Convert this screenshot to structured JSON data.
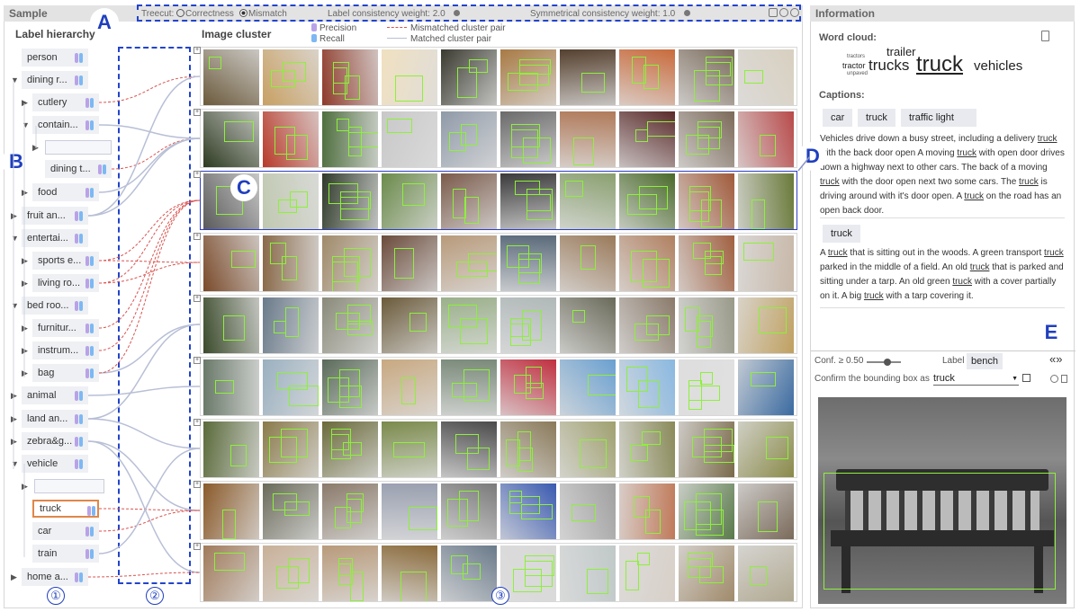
{
  "sample_title": "Sample",
  "info_title": "Information",
  "toolbar": {
    "treecut_label": "Treecut:",
    "opt_correctness": "Correctness",
    "opt_mismatch": "Mismatch",
    "label_weight": "Label consistency weight: 2.0",
    "sym_weight": "Symmetrical consistency weight: 1.0"
  },
  "badges": {
    "a": "A",
    "b": "B",
    "c": "C",
    "d": "D",
    "e": "E"
  },
  "col_numbers": [
    "①",
    "②",
    "③"
  ],
  "hierarchy_title": "Label hierarchy",
  "cluster_title": "Image cluster",
  "legend": {
    "precision": "Precision",
    "recall": "Recall",
    "mismatched": "Mismatched cluster pair",
    "matched": "Matched cluster pair",
    "precision_color": "#b9a3e8",
    "recall_color": "#7db8f2",
    "mismatched_color": "#d9534f",
    "matched_color": "#b8bfd6"
  },
  "tree_nodes": [
    {
      "label": "person",
      "expanded": null
    },
    {
      "label": "dining r...",
      "expanded": true
    },
    {
      "label": "cutlery",
      "expanded": false
    },
    {
      "label": "contain...",
      "expanded": true
    },
    {
      "label": "dining t...",
      "expanded": null
    },
    {
      "label": "food",
      "expanded": false
    },
    {
      "label": "fruit an...",
      "expanded": false
    },
    {
      "label": "entertai...",
      "expanded": true
    },
    {
      "label": "sports e...",
      "expanded": false
    },
    {
      "label": "living ro...",
      "expanded": false
    },
    {
      "label": "bed roo...",
      "expanded": true
    },
    {
      "label": "furnitur...",
      "expanded": false
    },
    {
      "label": "instrum...",
      "expanded": false
    },
    {
      "label": "bag",
      "expanded": false
    },
    {
      "label": "animal",
      "expanded": false
    },
    {
      "label": "land an...",
      "expanded": false
    },
    {
      "label": "zebra&g...",
      "expanded": false
    },
    {
      "label": "vehicle",
      "expanded": true
    },
    {
      "label": "truck",
      "expanded": null
    },
    {
      "label": "car",
      "expanded": null
    },
    {
      "label": "train",
      "expanded": null
    },
    {
      "label": "home a...",
      "expanded": false
    }
  ],
  "information": {
    "word_cloud_title": "Word cloud:",
    "word_cloud": [
      "trailer",
      "tractors",
      "tractor",
      "unpaved",
      "trucks",
      "truck",
      "vehicles"
    ],
    "captions_title": "Captions:",
    "caption_groups": [
      {
        "tags": [
          "car",
          "truck",
          "traffic light"
        ],
        "text": "Vehicles drive down a busy street, including a delivery truck with the back door open A moving truck with open door drives down a highway next to other cars. The back of a moving truck with the door open next two some cars. The truck is driving around with it's door open. A truck on the road has an open back door."
      },
      {
        "tags": [
          "truck"
        ],
        "text": "A truck that is sitting out in the woods. A green transport truck parked in the middle of a field. An old truck that is parked and sitting under a tarp. An old green truck with a cover partially on it. A big truck with a tarp covering it."
      }
    ],
    "conf_label": "Conf. ≥ 0.50",
    "conf_value": 0.5,
    "label_caption": "Label",
    "label_value": "bench",
    "confirm_label": "Confirm the bounding box as",
    "confirm_value": "truck"
  }
}
